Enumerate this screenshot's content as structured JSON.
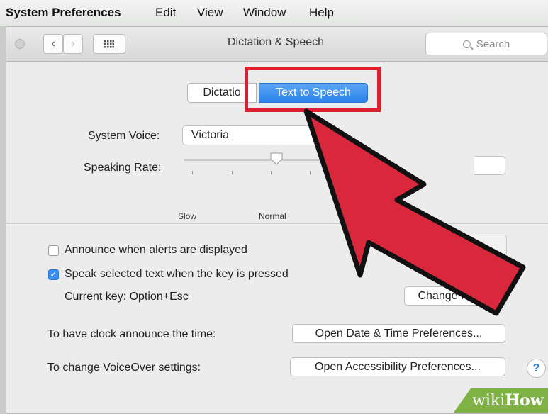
{
  "menubar": {
    "app_name": "System Preferences",
    "items": [
      "Edit",
      "View",
      "Window",
      "Help"
    ]
  },
  "window": {
    "title": "Dictation & Speech",
    "search_placeholder": "Search",
    "back_icon": "chevron-left-icon",
    "forward_icon": "chevron-right-icon",
    "grid_icon": "grid-icon"
  },
  "tabs": {
    "dictation": "Dictatio",
    "text_to_speech": "Text to Speech",
    "selected": "Text to Speech"
  },
  "voice": {
    "label": "System Voice:",
    "value": "Victoria"
  },
  "rate": {
    "label": "Speaking Rate:",
    "slow": "Slow",
    "normal": "Normal",
    "level": 0.35
  },
  "options": {
    "announce_alerts": {
      "label": "Announce when alerts are displayed",
      "checked": false
    },
    "speak_selected": {
      "label": "Speak selected text when the key is pressed",
      "checked": true
    },
    "current_key": "Current key: Option+Esc",
    "change_key_button": "Change Key…"
  },
  "clock": {
    "label": "To have clock announce the time:",
    "button": "Open Date & Time Preferences..."
  },
  "voiceover": {
    "label": "To change VoiceOver settings:",
    "button": "Open Accessibility Preferences..."
  },
  "help_button": "?",
  "watermark": {
    "prefix": "wiki",
    "suffix": "How"
  },
  "colors": {
    "highlight": "#df1f2f",
    "arrow_fill": "#d9283b",
    "selected_tab": "#2c82ec",
    "watermark_bg": "#7fb244"
  }
}
